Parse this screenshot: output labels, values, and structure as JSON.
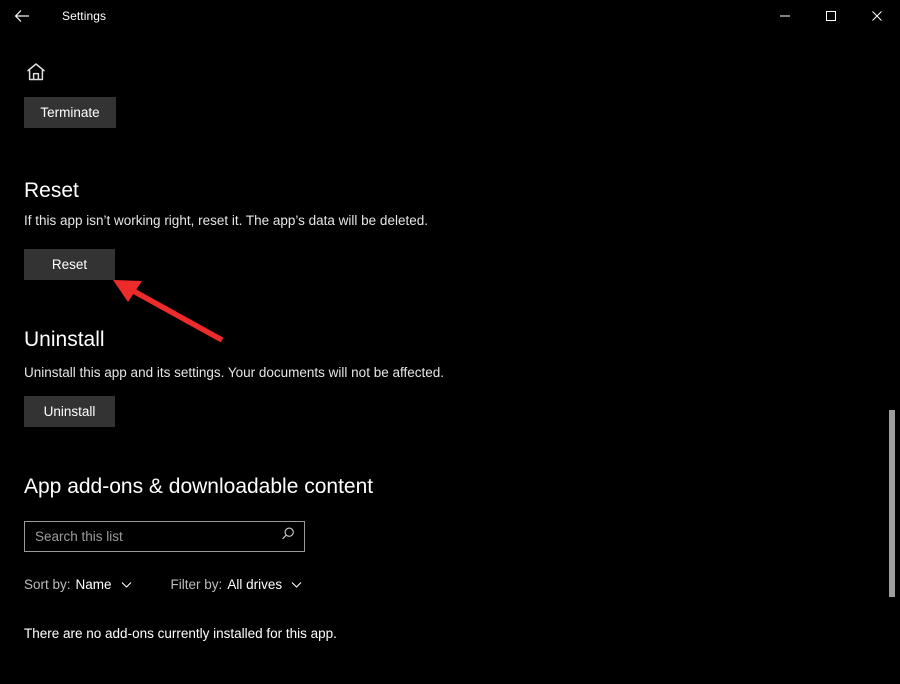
{
  "window": {
    "title": "Settings",
    "back_icon": "back-arrow-icon",
    "minimize_icon": "minimize-icon",
    "maximize_icon": "maximize-icon",
    "close_icon": "close-icon"
  },
  "nav": {
    "home_icon": "home-icon"
  },
  "terminate": {
    "button_label": "Terminate"
  },
  "reset": {
    "title": "Reset",
    "description": "If this app isn’t working right, reset it. The app’s data will be deleted.",
    "button_label": "Reset"
  },
  "uninstall": {
    "title": "Uninstall",
    "description": "Uninstall this app and its settings. Your documents will not be affected.",
    "button_label": "Uninstall"
  },
  "addons": {
    "title": "App add-ons & downloadable content",
    "search_placeholder": "Search this list",
    "search_value": "",
    "search_icon": "search-icon",
    "sort": {
      "label": "Sort by:",
      "value": "Name",
      "chevron_icon": "chevron-down-icon"
    },
    "filter": {
      "label": "Filter by:",
      "value": "All drives",
      "chevron_icon": "chevron-down-icon"
    },
    "empty_message": "There are no add-ons currently installed for this app."
  },
  "scrollbar": {
    "thumb_name": "vertical-scrollbar-thumb"
  },
  "annotation": {
    "arrow_name": "red-callout-arrow",
    "color": "#ee2b2b"
  },
  "theme": {
    "background": "#000000",
    "button_background": "#333333",
    "text": "#ffffff",
    "muted_text": "#bdbdbd",
    "border": "#9a9a9a",
    "scrollbar": "#9d9d9d"
  }
}
